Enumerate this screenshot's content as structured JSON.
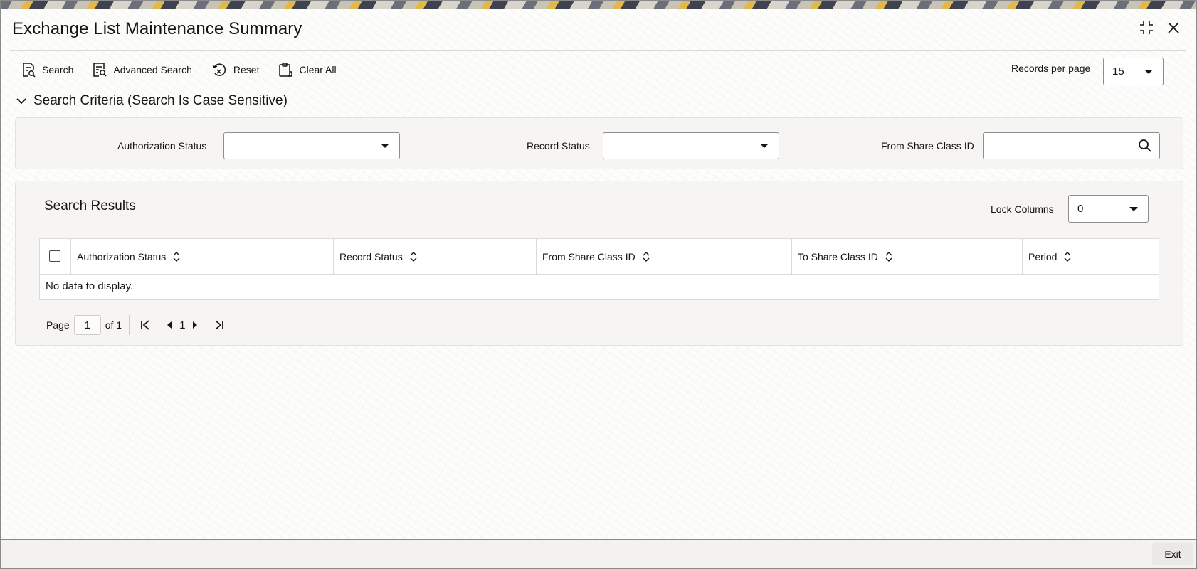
{
  "window": {
    "title": "Exchange List Maintenance Summary"
  },
  "toolbar": {
    "search_label": "Search",
    "advanced_search_label": "Advanced Search",
    "reset_label": "Reset",
    "clear_all_label": "Clear All",
    "records_per_page_label": "Records per page",
    "records_per_page_value": "15"
  },
  "criteria": {
    "heading": "Search Criteria (Search Is Case Sensitive)",
    "fields": {
      "authorization_status_label": "Authorization Status",
      "authorization_status_value": "",
      "record_status_label": "Record Status",
      "record_status_value": "",
      "from_share_class_label": "From Share Class ID",
      "from_share_class_value": ""
    }
  },
  "results": {
    "heading": "Search Results",
    "lock_columns_label": "Lock Columns",
    "lock_columns_value": "0",
    "columns": [
      "Authorization Status",
      "Record Status",
      "From Share Class ID",
      "To Share Class ID",
      "Period"
    ],
    "empty_message": "No data to display."
  },
  "pager": {
    "page_label": "Page",
    "page_value": "1",
    "of_label": "of 1",
    "current_page": "1"
  },
  "footer": {
    "exit_label": "Exit"
  },
  "icons": {
    "maximize": "maximize-icon",
    "close": "close-icon",
    "search": "search-doc-icon",
    "advanced_search": "advanced-search-icon",
    "reset": "reset-icon",
    "clear_all": "clipboard-icon",
    "collapse": "chevron-down-icon",
    "magnifier": "magnifier-icon",
    "sort": "sort-icon",
    "first": "first-page-icon",
    "prev": "prev-page-icon",
    "next": "next-page-icon",
    "last": "last-page-icon"
  }
}
